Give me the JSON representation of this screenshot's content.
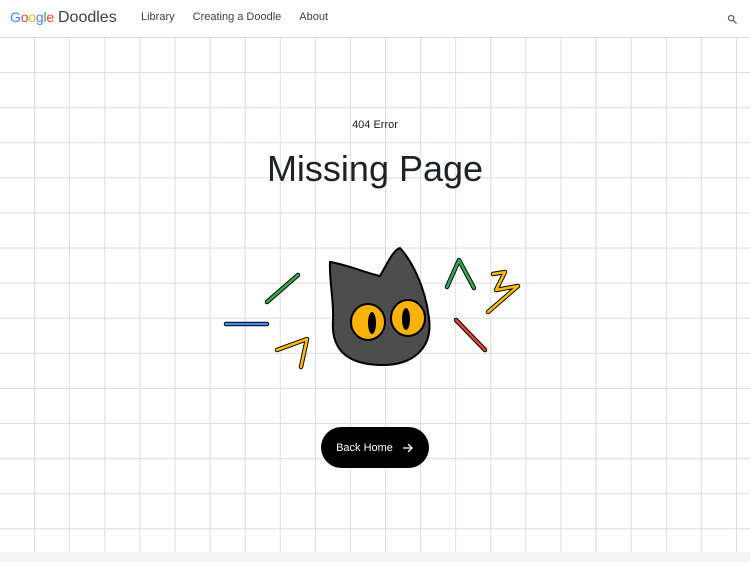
{
  "header": {
    "logo": {
      "brand_letters": [
        "G",
        "o",
        "o",
        "g",
        "l",
        "e"
      ],
      "product": "Doodles"
    },
    "nav": [
      {
        "label": "Library"
      },
      {
        "label": "Creating a Doodle"
      },
      {
        "label": "About"
      }
    ],
    "search_icon": "search-icon"
  },
  "main": {
    "error_code": "404 Error",
    "title": "Missing Page",
    "illustration": "surprised-cat-illustration",
    "back_button": {
      "label": "Back Home",
      "icon": "arrow-right-icon"
    }
  },
  "colors": {
    "google_blue": "#4285F4",
    "google_red": "#EA4335",
    "google_yellow": "#FBBC05",
    "google_green": "#34A853",
    "button_bg": "#000000",
    "cat_body": "#4d4d4d",
    "cat_eyes": "#F9B208",
    "grid_line": "#dadce0"
  }
}
